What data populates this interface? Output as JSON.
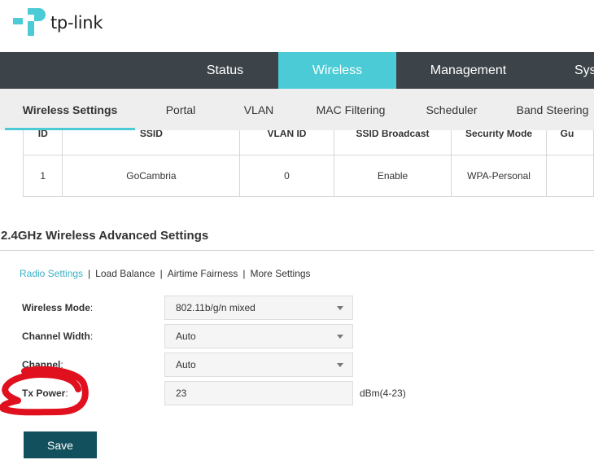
{
  "logo": {
    "text": "tp-link",
    "brand_color": "#4acbd6"
  },
  "main_nav": {
    "tabs": [
      {
        "label": "Status",
        "active": false
      },
      {
        "label": "Wireless",
        "active": true
      },
      {
        "label": "Management",
        "active": false
      },
      {
        "label": "Sys",
        "active": false
      }
    ]
  },
  "sub_nav": {
    "tabs": [
      {
        "label": "Wireless Settings",
        "active": true
      },
      {
        "label": "Portal",
        "active": false
      },
      {
        "label": "VLAN",
        "active": false
      },
      {
        "label": "MAC Filtering",
        "active": false
      },
      {
        "label": "Scheduler",
        "active": false
      },
      {
        "label": "Band Steering",
        "active": false
      }
    ]
  },
  "ssid_table": {
    "headers": [
      "ID",
      "SSID",
      "VLAN ID",
      "SSID Broadcast",
      "Security Mode",
      "Gu"
    ],
    "rows": [
      [
        "1",
        "GoCambria",
        "0",
        "Enable",
        "WPA-Personal",
        ""
      ]
    ]
  },
  "advanced": {
    "title": "2.4GHz Wireless Advanced Settings",
    "subtabs": [
      {
        "label": "Radio Settings",
        "active": true
      },
      {
        "label": "Load Balance",
        "active": false
      },
      {
        "label": "Airtime Fairness",
        "active": false
      },
      {
        "label": "More Settings",
        "active": false
      }
    ],
    "separator": "|",
    "fields": {
      "wireless_mode": {
        "label": "Wireless Mode",
        "value": "802.11b/g/n mixed"
      },
      "channel_width": {
        "label": "Channel Width",
        "value": "Auto"
      },
      "channel": {
        "label": "Channel",
        "value": "Auto"
      },
      "tx_power": {
        "label": "Tx Power",
        "value": "23",
        "unit": "dBm(4-23)"
      }
    },
    "label_suffix": ":",
    "save_label": "Save"
  },
  "colors": {
    "nav_bg": "#3d4449",
    "nav_active": "#4acbd6",
    "save_button": "#12505e",
    "annotation": "#e0101e"
  }
}
